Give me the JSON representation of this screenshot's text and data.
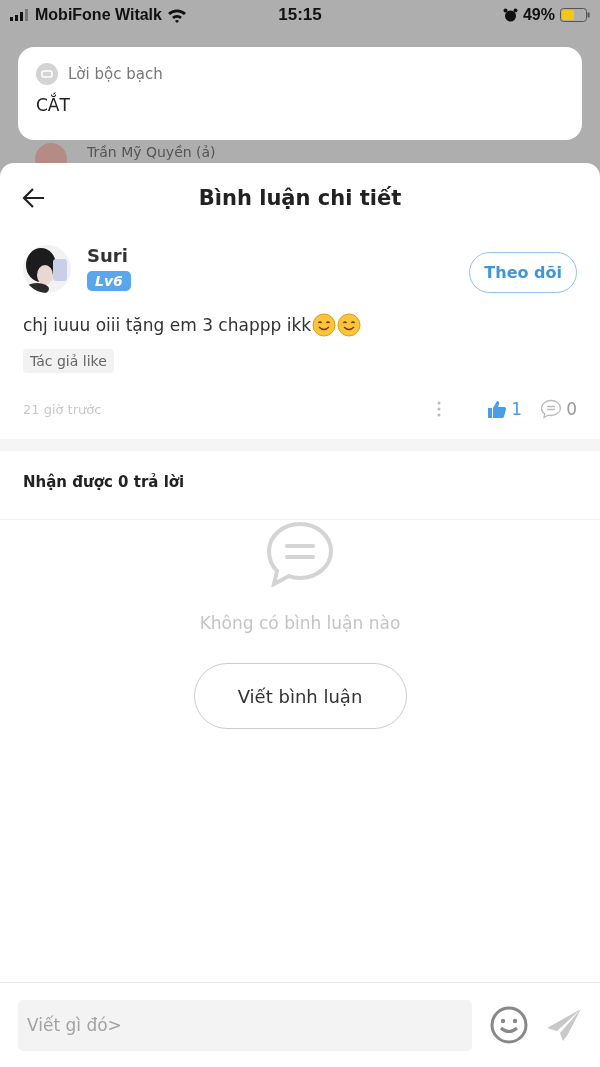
{
  "status_bar": {
    "carrier": "MobiFone Witalk",
    "time": "15:15",
    "battery": "49%"
  },
  "notification": {
    "app": "Lời bộc bạch",
    "message": "CẮT"
  },
  "background_row": {
    "name": "Trần Mỹ Quyền  (ả)"
  },
  "sheet": {
    "title": "Bình luận chi tiết"
  },
  "comment": {
    "author": "Suri",
    "level": "Lv6",
    "follow": "Theo dõi",
    "text": "chj iuuu oiii tặng em 3 chappp ikk",
    "emojis": [
      {
        "kind": "smile"
      },
      {
        "kind": "smile"
      }
    ],
    "tag": "Tác giả like",
    "time": "21 giờ trước",
    "likes": "1",
    "liked": true,
    "replies": "0"
  },
  "replies": {
    "header": "Nhận được 0 trả lời",
    "empty": "Không có bình luận nào",
    "write_button": "Viết bình luận"
  },
  "composer": {
    "placeholder": "Viết gì đó>"
  }
}
